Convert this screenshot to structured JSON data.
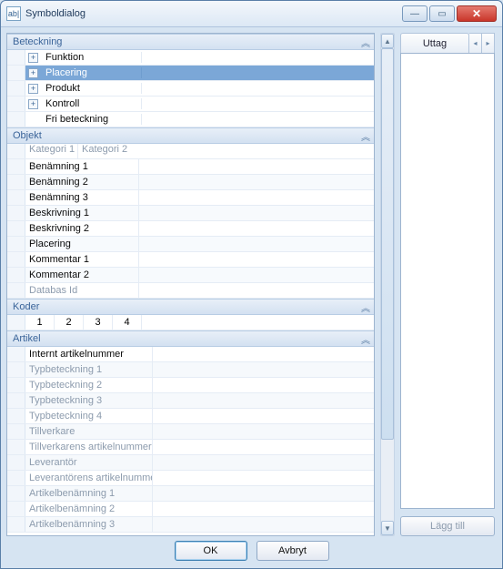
{
  "window": {
    "title": "Symboldialog"
  },
  "sections": {
    "beteckning": {
      "title": "Beteckning",
      "rows": [
        {
          "label": "Funktion",
          "expander": true,
          "selected": false
        },
        {
          "label": "Placering",
          "expander": true,
          "selected": true
        },
        {
          "label": "Produkt",
          "expander": true,
          "selected": false
        },
        {
          "label": "Kontroll",
          "expander": true,
          "selected": false
        },
        {
          "label": "Fri beteckning",
          "expander": false,
          "selected": false
        }
      ]
    },
    "objekt": {
      "title": "Objekt",
      "head1": "Kategori 1",
      "head2": "Kategori 2",
      "rows": [
        "Benämning 1",
        "Benämning 2",
        "Benämning 3",
        "Beskrivning 1",
        "Beskrivning 2",
        "Placering",
        "Kommentar 1",
        "Kommentar 2",
        "Databas Id"
      ]
    },
    "koder": {
      "title": "Koder",
      "values": [
        "1",
        "2",
        "3",
        "4"
      ]
    },
    "artikel": {
      "title": "Artikel",
      "rows": [
        {
          "label": "Internt artikelnummer",
          "dim": false
        },
        {
          "label": "Typbeteckning 1",
          "dim": true
        },
        {
          "label": "Typbeteckning 2",
          "dim": true
        },
        {
          "label": "Typbeteckning 3",
          "dim": true
        },
        {
          "label": "Typbeteckning 4",
          "dim": true
        },
        {
          "label": "Tillverkare",
          "dim": true
        },
        {
          "label": "Tillverkarens artikelnummer",
          "dim": true
        },
        {
          "label": "Leverantör",
          "dim": true
        },
        {
          "label": "Leverantörens artikelnummer",
          "dim": true
        },
        {
          "label": "Artikelbenämning 1",
          "dim": true
        },
        {
          "label": "Artikelbenämning 2",
          "dim": true
        },
        {
          "label": "Artikelbenämning 3",
          "dim": true
        }
      ]
    }
  },
  "right": {
    "tab": "Uttag",
    "add": "Lägg till"
  },
  "buttons": {
    "ok": "OK",
    "cancel": "Avbryt"
  }
}
